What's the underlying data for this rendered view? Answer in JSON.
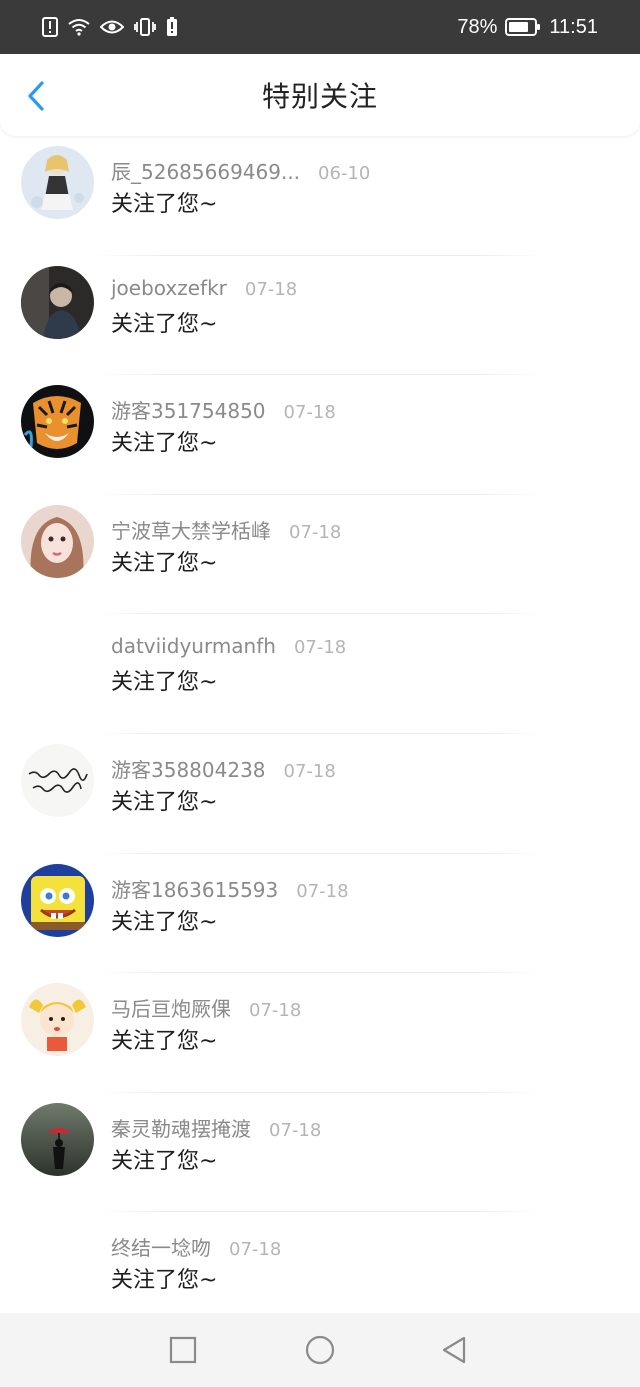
{
  "status": {
    "battery_pct": "78%",
    "time": "11:51"
  },
  "header": {
    "title": "特别关注"
  },
  "items": [
    {
      "name": "辰_52685669469...",
      "date": "06-10",
      "message": "关注了您~",
      "avatar": "anime-girl"
    },
    {
      "name": "joeboxzefkr",
      "date": "07-18",
      "message": "关注了您~",
      "avatar": "dark-photo"
    },
    {
      "name": "游客351754850",
      "date": "07-18",
      "message": "关注了您~",
      "avatar": "tiger"
    },
    {
      "name": "宁波草大禁学栝峰",
      "date": "07-18",
      "message": "关注了您~",
      "avatar": "girl-photo"
    },
    {
      "name": "datviidyurmanfh",
      "date": "07-18",
      "message": "关注了您~",
      "avatar": "none"
    },
    {
      "name": "游客358804238",
      "date": "07-18",
      "message": "关注了您~",
      "avatar": "calligraphy"
    },
    {
      "name": "游客1863615593",
      "date": "07-18",
      "message": "关注了您~",
      "avatar": "sponge"
    },
    {
      "name": "马后亘炮厥倮",
      "date": "07-18",
      "message": "关注了您~",
      "avatar": "cartoon-girl"
    },
    {
      "name": "秦灵勒魂摆掩渡",
      "date": "07-18",
      "message": "关注了您~",
      "avatar": "umbrella"
    },
    {
      "name": "终结一埝吻",
      "date": "07-18",
      "message": "关注了您~",
      "avatar": "none"
    }
  ],
  "colors": {
    "status_bar": "#3a3a3a",
    "accent": "#2a9af0",
    "name_text": "#8a8a8a",
    "date_text": "#b5b5b5"
  }
}
